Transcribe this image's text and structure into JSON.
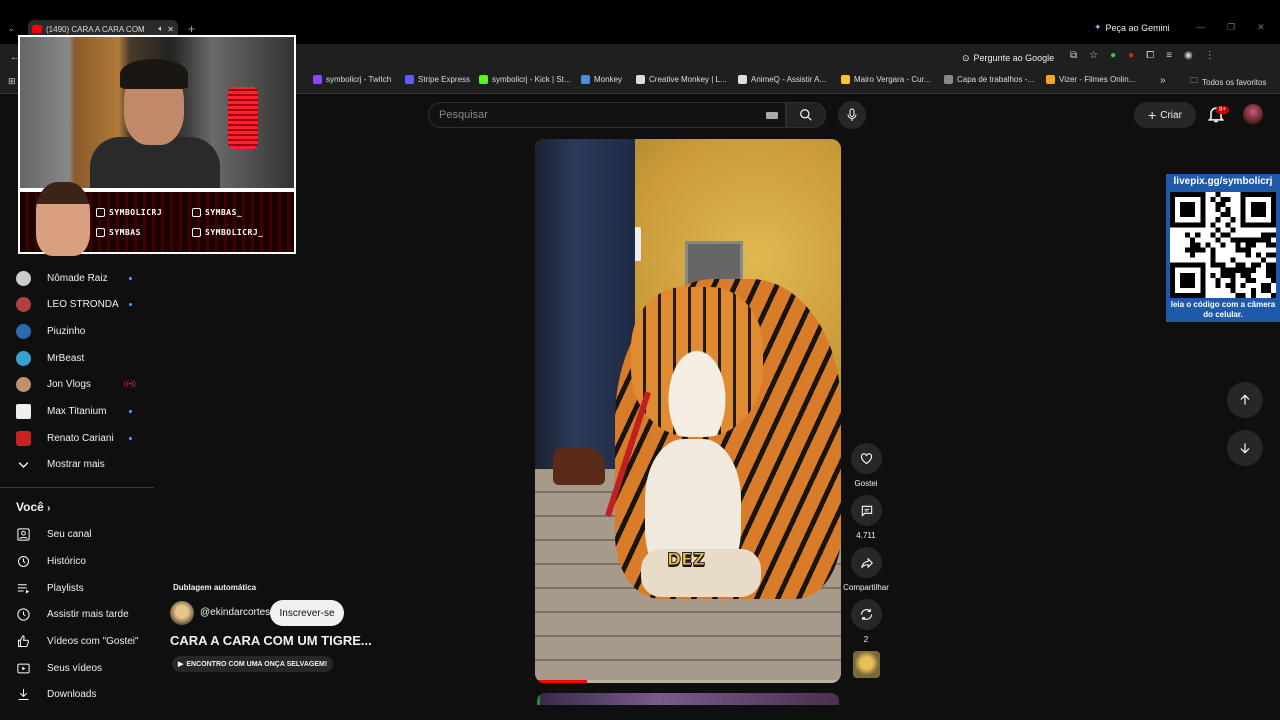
{
  "browser": {
    "tab_title": "(1490) CARA A CARA COM",
    "gemini_label": "Peça ao Gemini",
    "ask_google_label": "Pergunte ao Google",
    "bookmarks": [
      "symbolicrj - Twitch",
      "Stripe Express",
      "symbolicrj - Kick | St...",
      "Monkey",
      "Creative Monkey | L...",
      "AnimeQ - Assistir A...",
      "Mairo Vergara - Cur...",
      "Capa de trabalhos -...",
      "Vizer - Filmes Onlin..."
    ],
    "bookmark_colors": [
      "#9146ff",
      "#635bff",
      "#53fc18",
      "#4a90e2",
      "#dddddd",
      "#dddddd",
      "#f4c430",
      "#888888",
      "#f5a623"
    ],
    "more_bookmarks": "»",
    "all_favorites": "Todos os favoritos"
  },
  "header": {
    "search_placeholder": "Pesquisar",
    "create_label": "Criar",
    "notification_badge": "9+"
  },
  "overlay": {
    "handles": [
      "SYMBOLICRJ",
      "SYMBAS_",
      "SYMBAS",
      "SYMBOLICRJ_"
    ]
  },
  "sidebar": {
    "subscriptions": [
      {
        "name": "Nômade Raiz",
        "color": "#cccccc",
        "new": true
      },
      {
        "name": "LEO STRONDA",
        "color": "#b04040",
        "new": true
      },
      {
        "name": "Piuzinho",
        "color": "#2a6ab0",
        "new": false
      },
      {
        "name": "MrBeast",
        "color": "#3aa0d0",
        "new": false
      },
      {
        "name": "Jon Vlogs",
        "color": "#c09070",
        "new": false,
        "live": true
      },
      {
        "name": "Max Titanium",
        "color": "#eeeeee",
        "new": true
      },
      {
        "name": "Renato Cariani",
        "color": "#cc2020",
        "new": true
      }
    ],
    "show_more": "Mostrar mais",
    "section_you": "Você",
    "you_items": [
      "Seu canal",
      "Histórico",
      "Playlists",
      "Assistir mais tarde",
      "Vídeos com \"Gostei\"",
      "Seus vídeos",
      "Downloads"
    ]
  },
  "video": {
    "caption": "DEZ",
    "progress": 0.17
  },
  "actions": {
    "like_label": "Gostei",
    "comments_count": "4.711",
    "share_label": "Compartilhar",
    "remix_count": "2"
  },
  "info": {
    "auto_dub": "Dublagem automática",
    "channel_handle": "@ekindarcortes",
    "subscribe_label": "Inscrever-se",
    "title": "CARA A CARA COM UM TIGRE...",
    "music": "ENCONTRO COM UMA ONÇA SELVAGEM!"
  },
  "qr_panel": {
    "title": "livepix.gg/symbolicrj",
    "caption": "leia o código com a câmera do celular."
  }
}
